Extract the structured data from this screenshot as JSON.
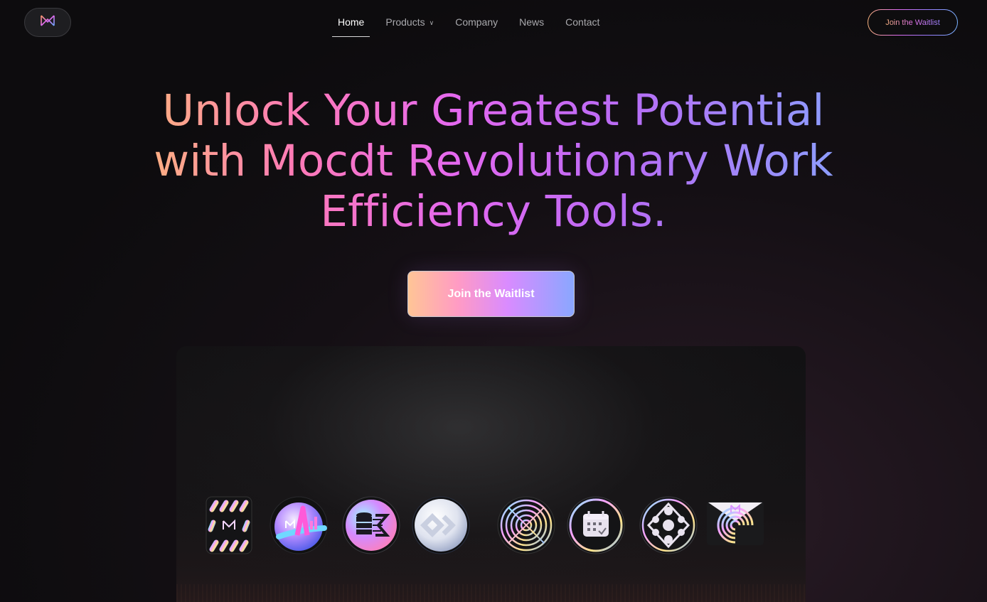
{
  "header": {
    "logo_icon": "mocdt-logo-icon",
    "nav": [
      {
        "label": "Home",
        "active": true
      },
      {
        "label": "Products",
        "has_dropdown": true
      },
      {
        "label": "Company"
      },
      {
        "label": "News"
      },
      {
        "label": "Contact"
      }
    ],
    "waitlist_button": "Join the Waitlist"
  },
  "hero": {
    "title_lines": [
      "Unlock Your Greatest Potential",
      "with Mocdt Revolutionary Work",
      "Efficiency Tools."
    ],
    "cta_label": "Join the Waitlist"
  },
  "showcase": {
    "icons": [
      "striped-logo-tile-icon",
      "analytics-orb-icon",
      "database-flow-icon",
      "loop-link-icon",
      "radial-target-icon",
      "calendar-check-icon",
      "network-nodes-icon",
      "envelope-spiral-icon"
    ]
  },
  "colors": {
    "gradient_start": "#ffb47e",
    "gradient_mid": "#e468f0",
    "gradient_end": "#8aa0ff",
    "background": "#0e0d0f"
  }
}
